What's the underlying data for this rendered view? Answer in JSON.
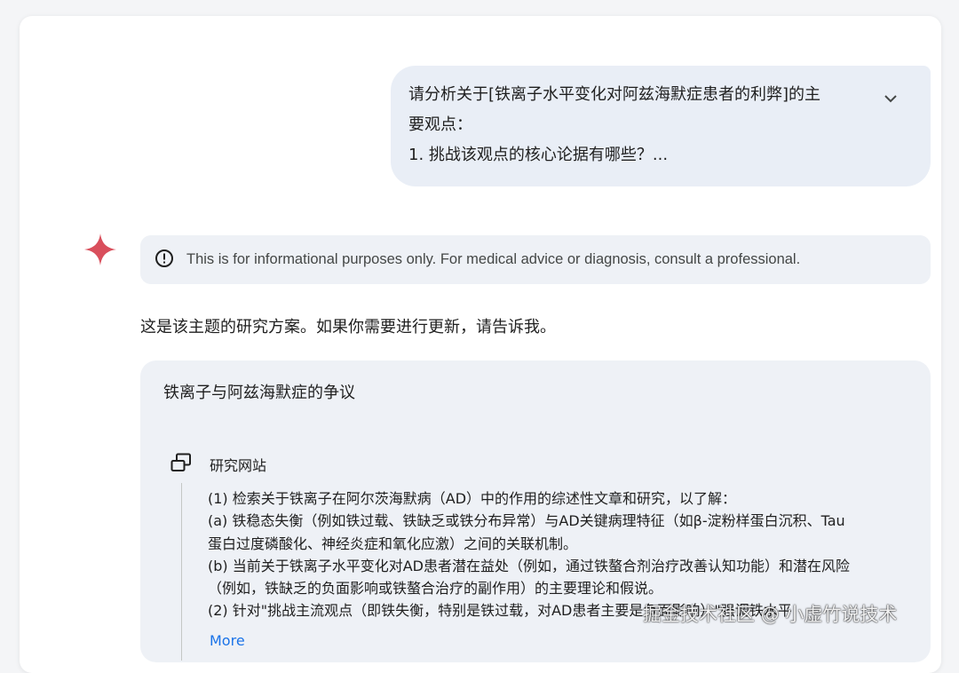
{
  "user_message": {
    "line1": "请分析关于[铁离子水平变化对阿兹海默症患者的利弊]的主",
    "line2": "要观点：",
    "line3": "1. 挑战该观点的核心论据有哪些？..."
  },
  "notice": {
    "icon": "info-icon",
    "text": "This is for informational purposes only. For medical advice or diagnosis, consult a professional."
  },
  "intro": "这是该主题的研究方案。如果你需要进行更新，请告诉我。",
  "plan": {
    "title": "铁离子与阿兹海默症的争议",
    "section_icon": "research-site-icon",
    "section_label": "研究网站",
    "steps": [
      "(1) 检索关于铁离子在阿尔茨海默病（AD）中的作用的综述性文章和研究，以了解：",
      "(a) 铁稳态失衡（例如铁过载、铁缺乏或铁分布异常）与AD关键病理特征（如β-淀粉样蛋白沉积、Tau",
      "蛋白过度磷酸化、神经炎症和氧化应激）之间的关联机制。",
      "(b) 当前关于铁离子水平变化对AD患者潜在益处（例如，通过铁螯合剂治疗改善认知功能）和潜在风险",
      "（例如，铁缺乏的负面影响或铁螯合治疗的副作用）的主要理论和假说。",
      "(2) 针对\"挑战主流观点（即铁失衡，特别是铁过载，对AD患者主要是负面影响）\"强调铁水平"
    ],
    "more_label": "More"
  },
  "watermark": "掘金技术社区 @ 小虚竹说技术",
  "colors": {
    "user_bubble": "#e9eef6",
    "notice_bg": "#eef1f6",
    "spark": "#d94f5c",
    "link": "#1a73e8"
  }
}
